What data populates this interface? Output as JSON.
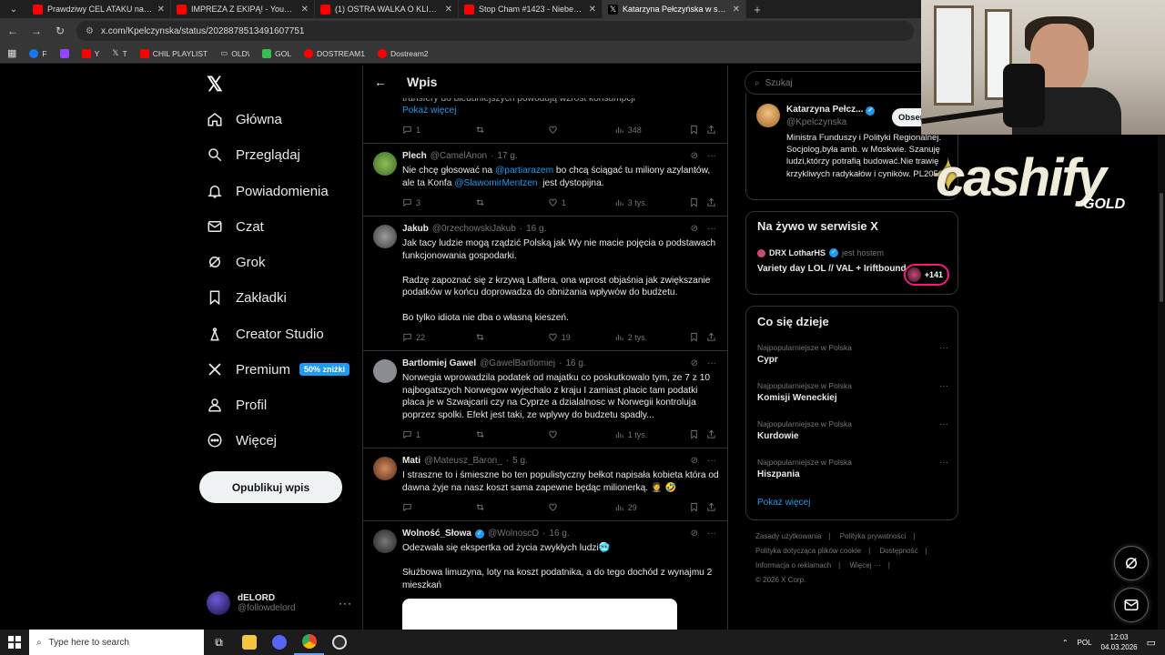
{
  "browser": {
    "tabs": [
      {
        "title": "Prawdziwy CEL ATAKU na IRAN",
        "color": "#ff0000"
      },
      {
        "title": "IMPREZA Z EKIPĄ! - YouTube",
        "color": "#ff0000"
      },
      {
        "title": "(1) OSTRA WALKA O KLIENTA, (",
        "color": "#ff0000"
      },
      {
        "title": "Stop Cham #1423 - Niebezpiec",
        "color": "#ff0000"
      },
      {
        "title": "Katarzyna Pełczyńska w serwis",
        "color": "#ffffff",
        "active": true
      }
    ],
    "new_tab": "+",
    "url": "x.com/Kpelczynska/status/2028878513491607751",
    "bookmarks": [
      {
        "label": "F",
        "color": "#1877f2"
      },
      {
        "label": "",
        "color": "#9146ff"
      },
      {
        "label": "Y",
        "color": "#ff0000"
      },
      {
        "label": "T",
        "color": "#ffffff"
      },
      {
        "label": "CHIL PLAYLIST",
        "color": "#ff0000"
      },
      {
        "label": "OLD\\",
        "color": "#cccccc"
      },
      {
        "label": "GOL",
        "color": "#3cba54"
      },
      {
        "label": "DOSTREAM1",
        "color": "#ff0000"
      },
      {
        "label": "Dostream2",
        "color": "#ff0000"
      }
    ]
  },
  "nav": {
    "logo": "𝕏",
    "items": [
      {
        "label": "Główna",
        "icon": "home-icon"
      },
      {
        "label": "Przeglądaj",
        "icon": "search-icon"
      },
      {
        "label": "Powiadomienia",
        "icon": "bell-icon"
      },
      {
        "label": "Czat",
        "icon": "mail-icon"
      },
      {
        "label": "Grok",
        "icon": "grok-icon"
      },
      {
        "label": "Zakładki",
        "icon": "bookmark-icon"
      },
      {
        "label": "Creator Studio",
        "icon": "creator-icon"
      },
      {
        "label": "Premium",
        "icon": "x-icon",
        "badge": "50% zniżki"
      },
      {
        "label": "Profil",
        "icon": "person-icon"
      },
      {
        "label": "Więcej",
        "icon": "more-icon"
      }
    ],
    "post_button": "Opublikuj wpis",
    "account": {
      "name": "dELORD",
      "handle": "@followdelord"
    }
  },
  "center": {
    "header": "Wpis",
    "partial_tweet": {
      "text": "transfery do bieduniejszych powodują wzrost konsumpcji",
      "show_more": "Pokaż więcej",
      "replies": "1",
      "retweets": "",
      "likes": "",
      "views": "348"
    },
    "tweets": [
      {
        "name": "Plech",
        "handle": "@CamelAnon",
        "time": "17 g.",
        "text_parts": [
          {
            "t": "Nie chcę głosować na ",
            "m": false
          },
          {
            "t": "@partiarazem",
            "m": true
          },
          {
            "t": " bo chcą ściągać tu miliony azylantów, ale ta Konfa ",
            "m": false
          },
          {
            "t": "@SlawomirMentzen",
            "m": true
          },
          {
            "t": "  jest dystopijna.",
            "m": false
          }
        ],
        "replies": "3",
        "retweets": "",
        "likes": "1",
        "views": "3 tys.",
        "avatar": "#5b8c3a"
      },
      {
        "name": "Jakub",
        "handle": "@0rzechowskiJakub",
        "time": "16 g.",
        "text": "Jak tacy ludzie mogą rządzić Polską jak Wy nie macie pojęcia o podstawach funkcjonowania gospodarki.\n\nRadzę zapoznać się z krzywą Laffera, ona wprost objaśnia jak zwiększanie podatków w końcu doprowadza do obniżania wpływów do budżetu.\n\nBo tylko idiota nie dba o własną kieszeń.",
        "replies": "22",
        "retweets": "",
        "likes": "19",
        "views": "2 tys.",
        "avatar": "#6e6e6e"
      },
      {
        "name": "Bartlomiej Gawel",
        "handle": "@GawelBartlomiej",
        "time": "16 g.",
        "text": "Norwegia wprowadzila podatek od majatku co poskutkowalo tym, ze 7 z 10 najbogatszych Norwegow wyjechalo z kraju I zamiast placic tam podatki placa je w Szwajcarii czy na Cyprze a dzialalnosc w Norwegii kontroluja poprzez spolki. Efekt jest taki, ze wplywy do budzetu spadly...",
        "replies": "1",
        "retweets": "",
        "likes": "",
        "views": "1 tys.",
        "avatar": "#8a8d91"
      },
      {
        "name": "Mati",
        "handle": "@Mateusz_Baron_",
        "time": "5 g.",
        "text": "I straszne to i śmieszne bo ten populistyczny bełkot napisała kobieta która od dawna żyje na nasz koszt sama zapewne będąc milionerką. 🤵 🤣",
        "replies": "",
        "retweets": "",
        "likes": "",
        "views": "29",
        "avatar": "#a3452b"
      },
      {
        "name": "Wolność_Słowa",
        "handle": "@WolnoscO",
        "time": "16 g.",
        "verified": true,
        "text": "Odezwała się ekspertka od życia zwykłych ludzi🥶\n\nSłużbowa limuzyna, loty na koszt podatnika, a do tego dochód z wynajmu 2 mieszkań",
        "avatar": "#3a3a3a"
      }
    ]
  },
  "right": {
    "search_placeholder": "Szukaj",
    "profile": {
      "name": "Katarzyna Pełcz...",
      "handle": "@Kpelczynska",
      "follow": "Obserwuj",
      "bio": "Ministra Funduszy i Polityki Regionalnej. Socjolog,była amb. w Moskwie. Szanuję ludzi,którzy potrafią budować.Nie trawię krzykliwych radykałów i cyników. PL2050"
    },
    "live": {
      "title": "Na żywo w serwisie X",
      "host": "DRX LotharHS",
      "host_suffix": "jest hostem",
      "stream_title": "Variety day LOL // VAL + Iriftbound",
      "count": "+141"
    },
    "trends": {
      "title": "Co się dzieje",
      "items": [
        {
          "category": "Najpopularniejsze w Polska",
          "name": "Cypr"
        },
        {
          "category": "Najpopularniejsze w Polska",
          "name": "Komisji Weneckiej"
        },
        {
          "category": "Najpopularniejsze w Polska",
          "name": "Kurdowie"
        },
        {
          "category": "Najpopularniejsze w Polska",
          "name": "Hiszpania"
        }
      ],
      "more": "Pokaż więcej"
    },
    "footer": [
      "Zasady użytkowania",
      "Polityka prywatności",
      "Polityka dotycząca plików cookie",
      "Dostępność",
      "Informacja o reklamach",
      "Więcej ···",
      "© 2026 X Corp."
    ]
  },
  "overlay": {
    "brand": "cashify",
    "sub": "GOLD"
  },
  "taskbar": {
    "search_placeholder": "Type here to search",
    "lang": "POL",
    "time": "12:03",
    "date": "04.03.2026"
  }
}
